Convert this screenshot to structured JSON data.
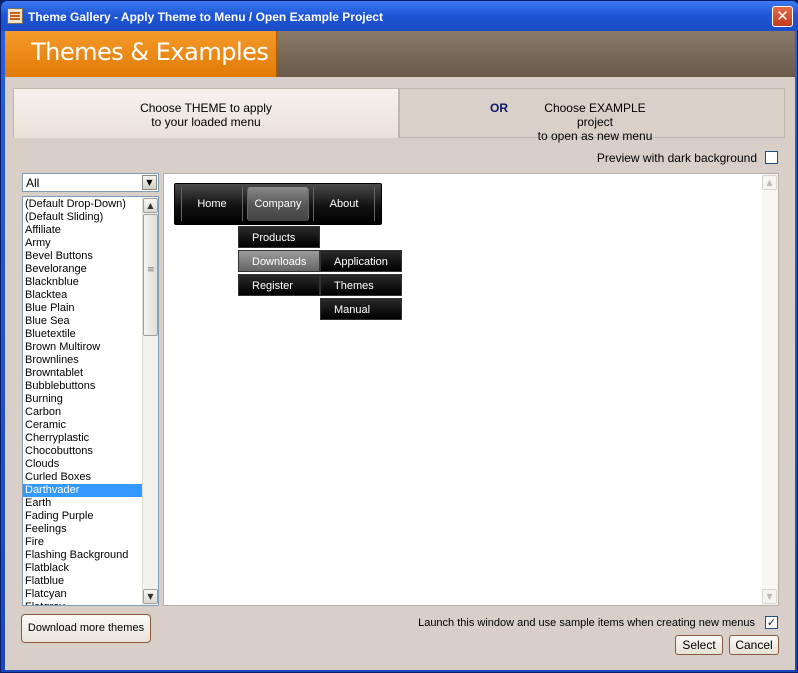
{
  "window": {
    "title": "Theme Gallery - Apply Theme to Menu / Open Example Project",
    "close_label": "✕"
  },
  "header": {
    "title": "Themes & Examples"
  },
  "tabs": {
    "theme": {
      "line1": "Choose THEME to apply",
      "line2": "to your loaded menu"
    },
    "or_label": "OR",
    "example": {
      "line1": "Choose EXAMPLE project",
      "line2": "to open as new menu"
    }
  },
  "preview_toggle": {
    "label": "Preview with dark background",
    "checked": false
  },
  "filter": {
    "selected": "All"
  },
  "themes": {
    "selected": "Darthvader",
    "items": [
      "(Default Drop-Down)",
      "(Default Sliding)",
      "Affiliate",
      "Army",
      "Bevel Buttons",
      "Bevelorange",
      "Blacknblue",
      "Blacktea",
      "Blue Plain",
      "Blue Sea",
      "Bluetextile",
      "Brown Multirow",
      "Brownlines",
      "Browntablet",
      "Bubblebuttons",
      "Burning",
      "Carbon",
      "Ceramic",
      "Cherryplastic",
      "Chocobuttons",
      "Clouds",
      "Curled Boxes",
      "Darthvader",
      "Earth",
      "Fading Purple",
      "Feelings",
      "Fire",
      "Flashing Background",
      "Flatblack",
      "Flatblue",
      "Flatcyan",
      "Flatgray"
    ]
  },
  "preview_menu": {
    "top": [
      "Home",
      "Company",
      "About"
    ],
    "sub1": [
      "Products",
      "Downloads",
      "Register"
    ],
    "sub2": [
      "Application",
      "Themes",
      "Manual"
    ]
  },
  "footer": {
    "download_label": "Download more themes",
    "launch_label": "Launch this window and use sample items when creating new menus",
    "launch_checked": true,
    "check_mark": "✓",
    "select_label": "Select",
    "cancel_label": "Cancel"
  },
  "icons": {
    "up": "▲",
    "down": "▼",
    "dropdown": "▼"
  }
}
